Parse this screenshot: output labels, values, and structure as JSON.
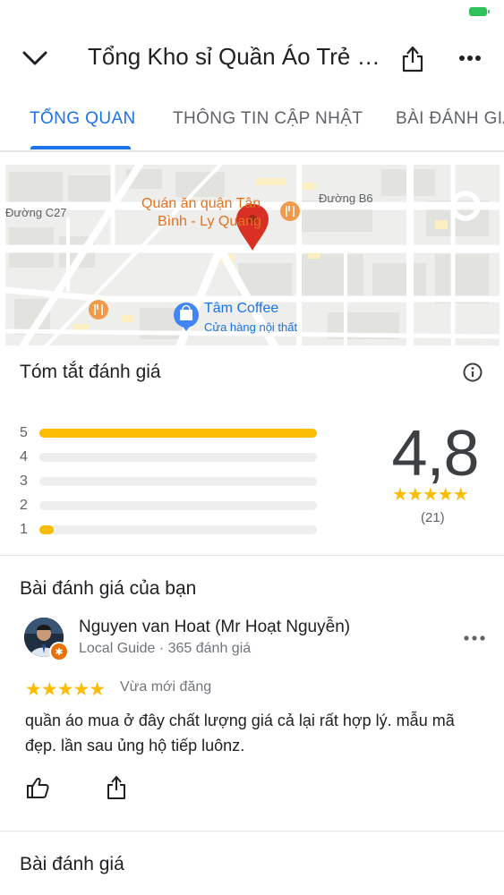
{
  "header": {
    "title": "Tổng Kho sỉ Quần Áo Trẻ Em",
    "icons": [
      "chevron-down-icon",
      "share-icon",
      "more-icon"
    ]
  },
  "tabs": [
    {
      "label": "TỔNG QUAN",
      "active": true
    },
    {
      "label": "THÔNG TIN CẬP NHẬT",
      "active": false
    },
    {
      "label": "BÀI ĐÁNH GIÁ",
      "active": false
    }
  ],
  "map": {
    "labels": {
      "street_c27": "Đường C27",
      "street_b6": "Đường B6",
      "poi_line1": "Quán ăn quận Tân",
      "poi_line2": "Bình - Ly Quang",
      "coffee_name": "Tâm Coffee",
      "coffee_sub": "Cửa hàng nội thất"
    }
  },
  "summary": {
    "title": "Tóm tắt đánh giá",
    "rating": "4,8",
    "stars": "★★★★★",
    "count": "(21)",
    "distribution": [
      {
        "label": "5",
        "fraction": 1.0
      },
      {
        "label": "4",
        "fraction": 0.0
      },
      {
        "label": "3",
        "fraction": 0.0
      },
      {
        "label": "2",
        "fraction": 0.0
      },
      {
        "label": "1",
        "fraction": 0.05
      }
    ]
  },
  "your_review": {
    "title": "Bài đánh giá của bạn",
    "name": "Nguyen van Hoat (Mr Hoạt Nguyễn)",
    "guide": "Local Guide · 365 đánh giá",
    "stars": "★★★★★",
    "posted": "Vừa mới đăng",
    "text": "quần áo mua ở đây chất lượng giá cả lại rất hợp lý. mẫu mã đẹp. lần sau ủng hộ tiếp luônz."
  },
  "reviews": {
    "title": "Bài đánh giá"
  },
  "colors": {
    "accent": "#1a73e8",
    "star": "#fbbc04",
    "pin": "#d93025",
    "battery": "#2fc15a"
  }
}
